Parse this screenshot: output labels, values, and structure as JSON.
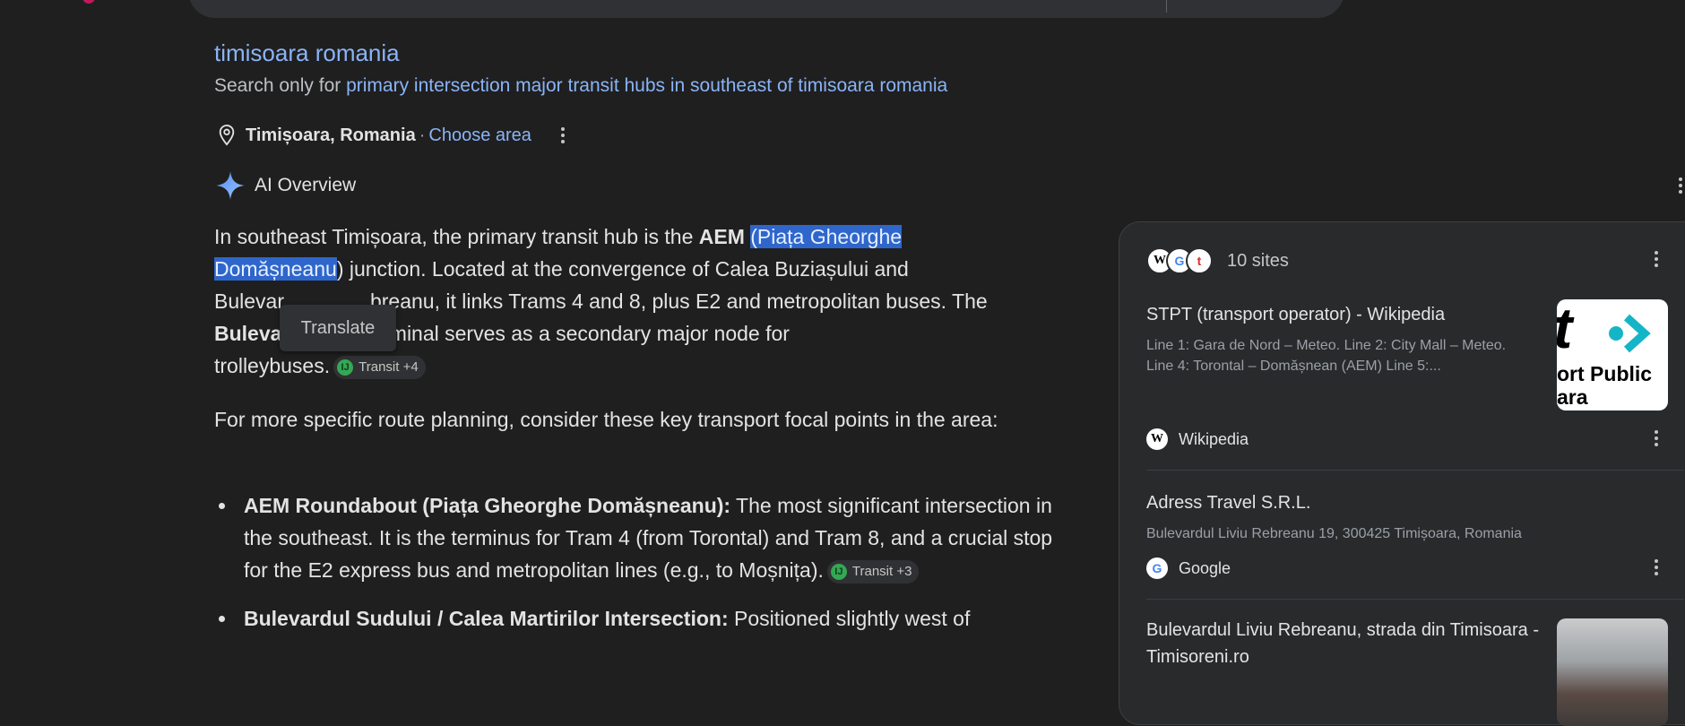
{
  "header": {
    "query_tail": "timisoara romania",
    "search_only_prefix": "Search only for ",
    "search_only_query": "primary intersection major transit hubs in southeast of timisoara romania"
  },
  "location": {
    "city": "Timișoara, Romania",
    "separator": "·",
    "choose_area": "Choose area"
  },
  "ai_overview": {
    "label": "AI Overview",
    "para1": {
      "t1": "In southeast Timișoara, the primary transit hub is the ",
      "b1": "AEM",
      "hl1": "(Piața Gheorghe",
      "hl2": "Domășneanu",
      "t2": ") junction. Located at the convergence of Calea Buziașului and",
      "t3": "Bulevar",
      "t3b": "breanu, it links Trams 4 and 8, plus E2 and metropolitan buses. The",
      "b2": "Buleva",
      "t4": "i terminal serves as a secondary major node for",
      "t5": "trolleybuses.",
      "chip": "Transit +4"
    },
    "tooltip": "Translate",
    "para2": "For more specific route planning, consider these key transport focal points in the area:",
    "bullets": [
      {
        "bold": "AEM Roundabout (Piața Gheorghe Domășneanu):",
        "text": " The most significant intersection in the southeast. It is the terminus for Tram 4 (from Torontal) and Tram 8, and a crucial stop for the E2 express bus and metropolitan lines (e.g., to Moșnița).",
        "chip": "Transit +3"
      },
      {
        "bold": "Bulevardul Sudului / Calea Martirilor Intersection:",
        "text": " Positioned slightly west of"
      }
    ]
  },
  "sources_panel": {
    "count_label": "10 sites",
    "cards": [
      {
        "title": "STPT (transport operator) - Wikipedia",
        "snippet": "Line 1: Gara de Nord – Meteo. Line 2: City Mall – Meteo. Line 4: Torontal – Domășnean (AEM) Line 5:...",
        "source": "Wikipedia",
        "thumb_text1": "ort Public",
        "thumb_text2": "ara"
      },
      {
        "title": "Adress Travel S.R.L.",
        "snippet": "Bulevardul Liviu Rebreanu 19, 300425 Timișoara, Romania",
        "source": "Google"
      },
      {
        "title": "Bulevardul Liviu Rebreanu, strada din Timisoara - Timisoreni.ro"
      }
    ]
  },
  "colors": {
    "background": "#1f1f1f",
    "link": "#8ab4f8",
    "highlight": "#2e66cc",
    "panel": "#282a2c"
  }
}
